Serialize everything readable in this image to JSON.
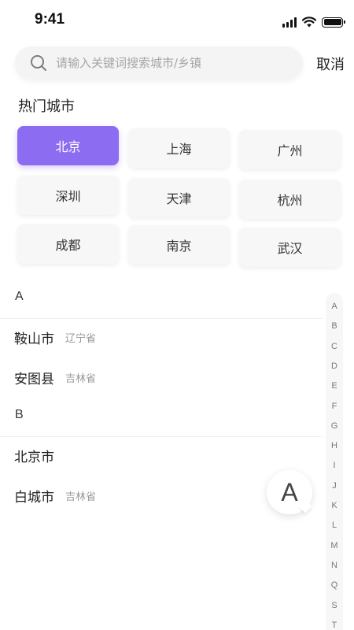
{
  "status_bar": {
    "time": "9:41"
  },
  "search": {
    "placeholder": "请输入关键词搜索城市/乡镇",
    "value": "",
    "cancel_label": "取消"
  },
  "hot_cities": {
    "title": "热门城市",
    "items": [
      {
        "name": "北京",
        "selected": true
      },
      {
        "name": "上海",
        "selected": false
      },
      {
        "name": "广州",
        "selected": false
      },
      {
        "name": "深圳",
        "selected": false
      },
      {
        "name": "天津",
        "selected": false
      },
      {
        "name": "杭州",
        "selected": false
      },
      {
        "name": "成都",
        "selected": false
      },
      {
        "name": "南京",
        "selected": false
      },
      {
        "name": "武汉",
        "selected": false
      }
    ]
  },
  "city_list": {
    "groups": [
      {
        "letter": "A",
        "cities": [
          {
            "name": "鞍山市",
            "province": "辽宁省"
          },
          {
            "name": "安图县",
            "province": "吉林省"
          }
        ]
      },
      {
        "letter": "B",
        "cities": [
          {
            "name": "北京市",
            "province": ""
          },
          {
            "name": "白城市",
            "province": "吉林省"
          }
        ]
      }
    ]
  },
  "index_bar": {
    "letters": [
      "A",
      "B",
      "C",
      "D",
      "E",
      "F",
      "G",
      "H",
      "I",
      "J",
      "K",
      "L",
      "M",
      "N",
      "Q",
      "S",
      "T"
    ]
  },
  "indicator": {
    "letter": "A"
  },
  "colors": {
    "accent": "#8c6cf0",
    "chip_bg": "#f7f7f7",
    "search_bg": "#f4f4f5"
  }
}
